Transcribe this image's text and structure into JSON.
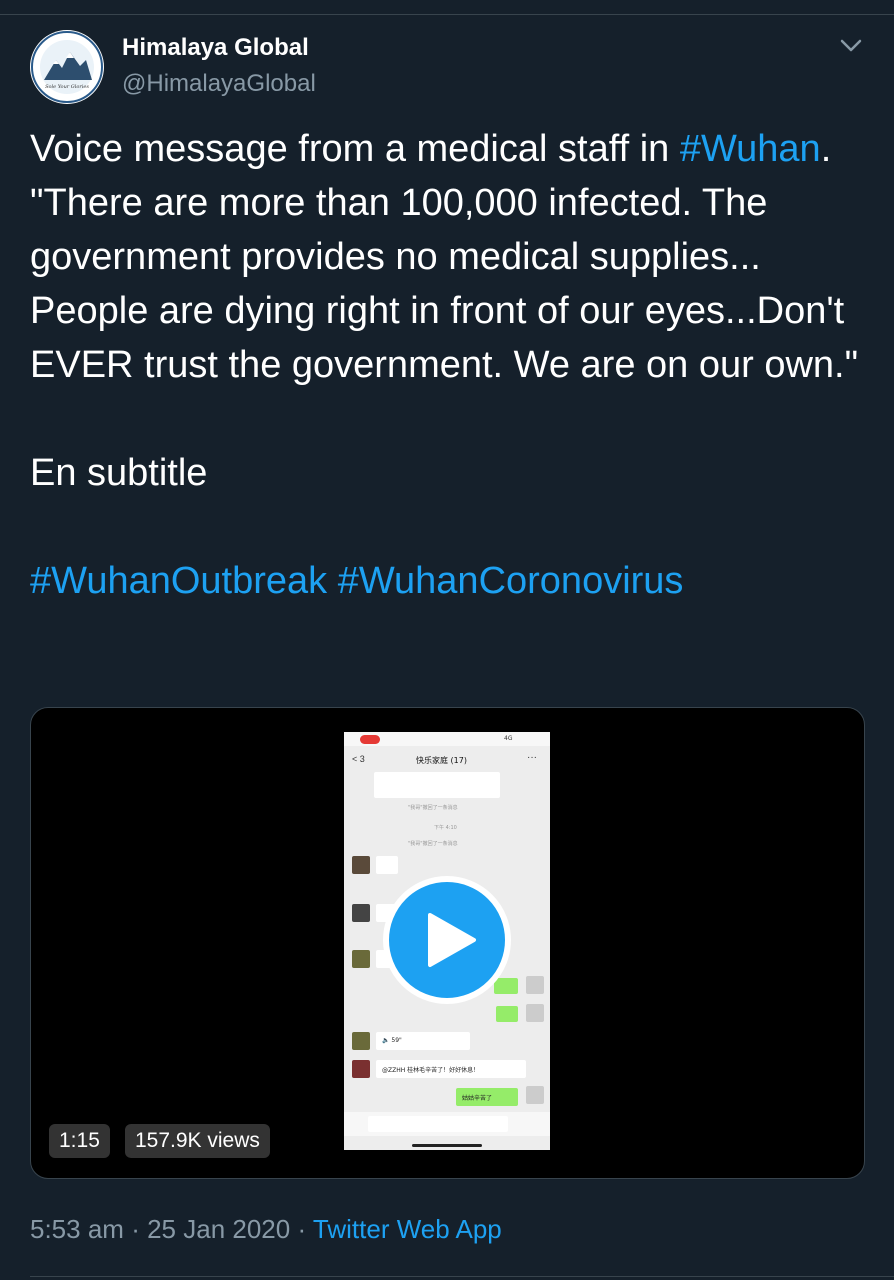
{
  "author": {
    "name": "Himalaya Global",
    "handle": "@HimalayaGlobal",
    "avatar_text": "HIMALAYA GLOBAL"
  },
  "tweet": {
    "line1_pre": "Voice message from a medical staff in",
    "hashtag_wuhan": "#Wuhan",
    "body_rest": ". \"There are more than 100,000 infected. The government provides no medical supplies... People are dying right in front of our eyes...Don't EVER trust the government. We are on our own.\"",
    "subtitle_note": "En subtitle",
    "hashtags": [
      "#WuhanOutbreak",
      "#WuhanCoronovirus"
    ]
  },
  "video": {
    "duration": "1:15",
    "views": "157.9K views",
    "phone": {
      "signal": "4G",
      "chat_title": "快乐家庭 (17)",
      "back_count": "3",
      "time_note": "下午 4:10",
      "voice_duration": "59\"",
      "msg_1": "@ZZHH 桂林毛辛苦了！好好休息！",
      "msg_2": "姑姑辛苦了"
    }
  },
  "meta": {
    "time": "5:53 am",
    "date": "25 Jan 2020",
    "separator": "·",
    "source": "Twitter Web App"
  },
  "colors": {
    "background": "#15202b",
    "link": "#1da1f2",
    "secondary": "#8899a6"
  },
  "icons": [
    "chevron-down-icon",
    "play-icon"
  ]
}
